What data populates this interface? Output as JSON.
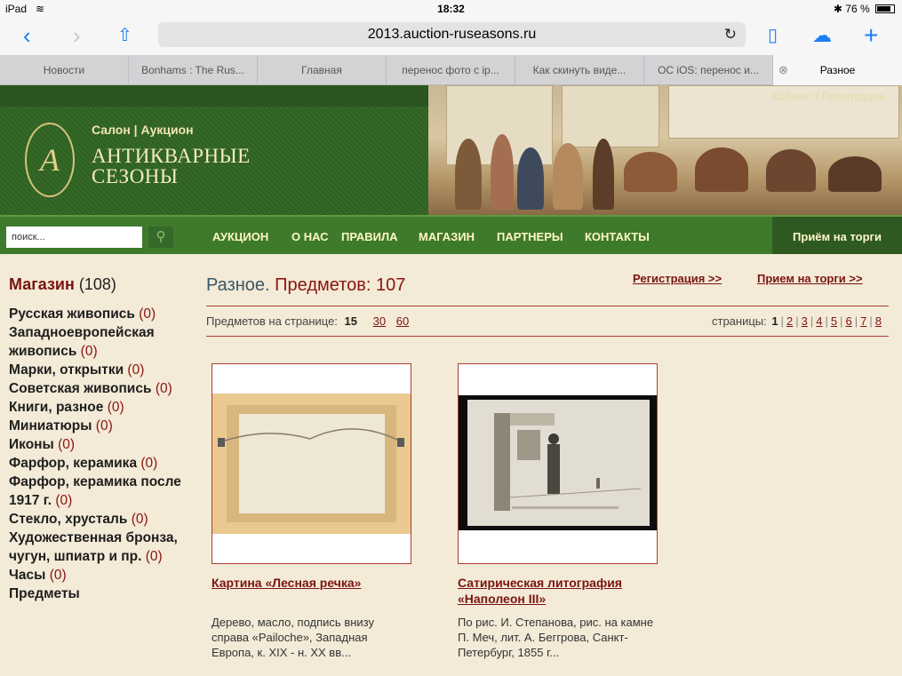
{
  "status": {
    "device": "iPad",
    "time": "18:32",
    "battery": "76 %"
  },
  "browser": {
    "url": "2013.auction-ruseasons.ru",
    "tabs": [
      {
        "label": "Новости"
      },
      {
        "label": "Bonhams : The Rus..."
      },
      {
        "label": "Главная"
      },
      {
        "label": "перенос фото с ip..."
      },
      {
        "label": "Как скинуть виде..."
      },
      {
        "label": "ОС iOS: перенос и..."
      },
      {
        "label": "Разное"
      }
    ]
  },
  "header": {
    "cabinet_link": "Кабинет / Регистрация",
    "subtitle": "Салон | Аукцион",
    "title_line1": "АНТИКВАРНЫЕ",
    "title_line2": "СЕЗОНЫ",
    "logo_letter": "А"
  },
  "menu": {
    "search_placeholder": "поиск...",
    "items": [
      "АУКЦИОН",
      "О НАС",
      "ПРАВИЛА",
      "МАГАЗИН",
      "ПАРТНЕРЫ",
      "КОНТАКТЫ"
    ],
    "accept": "Приём на торги"
  },
  "sidebar": {
    "title": "Магазин",
    "count": "(108)",
    "categories": [
      {
        "name": "Русская живопись",
        "count": "(0)"
      },
      {
        "name": "Западноевропейская живопись",
        "count": "(0)"
      },
      {
        "name": "Марки, открытки",
        "count": "(0)"
      },
      {
        "name": "Советская живопись",
        "count": "(0)"
      },
      {
        "name": "Книги, разное",
        "count": "(0)"
      },
      {
        "name": "Миниатюры",
        "count": "(0)"
      },
      {
        "name": "Иконы",
        "count": "(0)"
      },
      {
        "name": "Фарфор, керамика",
        "count": "(0)"
      },
      {
        "name": "Фарфор, керамика после 1917 г.",
        "count": "(0)"
      },
      {
        "name": "Стекло, хрусталь",
        "count": "(0)"
      },
      {
        "name": "Художественная бронза, чугун, шпиатр и пр.",
        "count": "(0)"
      },
      {
        "name": "Часы",
        "count": "(0)"
      },
      {
        "name": "Предметы",
        "count": ""
      }
    ]
  },
  "main": {
    "title": "Разное.",
    "count_label": "Предметов: 107",
    "register_link": "Регистрация >>",
    "accept_link": "Прием на торги >>",
    "per_page_label": "Предметов на странице:",
    "per_page_current": "15",
    "per_page_options": [
      "30",
      "60"
    ],
    "pages_label": "страницы:",
    "current_page": "1",
    "pages": [
      "2",
      "3",
      "4",
      "5",
      "6",
      "7",
      "8"
    ]
  },
  "items": [
    {
      "title": "Картина «Лесная речка»",
      "description": "Дерево, масло, подпись внизу справа «Pailoche», Западная Европа, к. XIX - н. XX вв..."
    },
    {
      "title": "Сатирическая литография «Наполеон III»",
      "description": "По рис. И. Степанова, рис. на камне П. Меч, лит. А. Беггрова, Санкт-Петербург, 1855 г..."
    }
  ]
}
